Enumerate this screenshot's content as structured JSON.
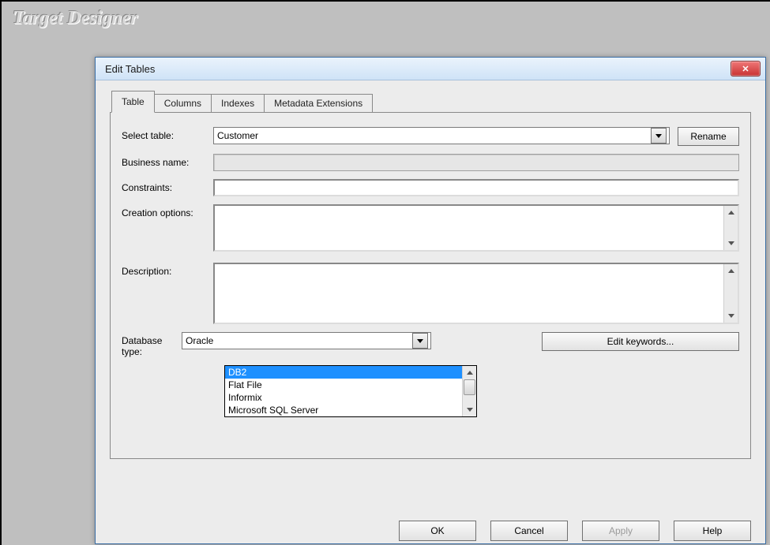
{
  "background_title": "Target Designer",
  "dialog": {
    "title": "Edit Tables",
    "tabs": [
      "Table",
      "Columns",
      "Indexes",
      "Metadata Extensions"
    ],
    "active_tab_index": 0,
    "labels": {
      "select_table": "Select table:",
      "business_name": "Business name:",
      "constraints": "Constraints:",
      "creation_options": "Creation options:",
      "description": "Description:",
      "database_type": "Database type:"
    },
    "fields": {
      "select_table_value": "Customer",
      "business_name_value": "",
      "constraints_value": "",
      "creation_options_value": "",
      "description_value": "",
      "database_type_value": "Oracle",
      "database_type_options": [
        "DB2",
        "Flat File",
        "Informix",
        "Microsoft SQL Server"
      ],
      "database_type_highlight_index": 0
    },
    "buttons": {
      "rename": "Rename",
      "edit_keywords": "Edit keywords...",
      "ok": "OK",
      "cancel": "Cancel",
      "apply": "Apply",
      "help": "Help"
    }
  }
}
